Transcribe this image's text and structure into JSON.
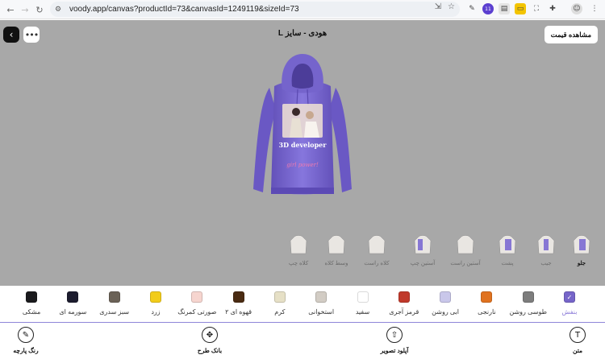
{
  "browser": {
    "url": "voody.app/canvas?productId=73&canvasId=1249119&sizeId=73",
    "extension_badge": "11"
  },
  "header": {
    "title": "هودی - سایز L",
    "price_button": "مشاهده قیمت"
  },
  "design": {
    "print_text": "3D developer",
    "print_subtext": "girl power!"
  },
  "views": [
    {
      "label": "جلو",
      "active": true,
      "color": "#7c6ad3"
    },
    {
      "label": "جیب",
      "active": false,
      "color": "#7c6ad3"
    },
    {
      "label": "پشت",
      "active": false,
      "color": "#7c6ad3"
    },
    {
      "label": "آستین راست",
      "active": false,
      "color": "#d7d4d0"
    },
    {
      "label": "آستین چپ",
      "active": false,
      "color": "#7c6ad3"
    },
    {
      "label": "کلاه راست",
      "active": false,
      "color": "#d7d4d0"
    },
    {
      "label": "وسط کلاه",
      "active": false,
      "color": "#d7d4d0"
    },
    {
      "label": "کلاه چپ",
      "active": false,
      "color": "#d7d4d0"
    }
  ],
  "colors": [
    {
      "name": "بنفش",
      "hex": "#7665c9",
      "selected": true
    },
    {
      "name": "طوسی روشن",
      "hex": "#7d7d7d",
      "selected": false
    },
    {
      "name": "نارنجی",
      "hex": "#e0721f",
      "selected": false
    },
    {
      "name": "ابی روشن",
      "hex": "#c9c7ea",
      "selected": false
    },
    {
      "name": "قرمز آجری",
      "hex": "#c0392b",
      "selected": false
    },
    {
      "name": "سفید",
      "hex": "#ffffff",
      "selected": false
    },
    {
      "name": "استخوانی",
      "hex": "#d2ccc4",
      "selected": false
    },
    {
      "name": "کرم",
      "hex": "#e6e0c6",
      "selected": false
    },
    {
      "name": "قهوه ای ۲",
      "hex": "#4a2b12",
      "selected": false
    },
    {
      "name": "صورتی کمرنگ",
      "hex": "#f6d5cf",
      "selected": false
    },
    {
      "name": "زرد",
      "hex": "#f2cc1a",
      "selected": false
    },
    {
      "name": "سبز سدری",
      "hex": "#6b6257",
      "selected": false
    },
    {
      "name": "سورمه ای",
      "hex": "#1c1c2e",
      "selected": false
    },
    {
      "name": "مشکی",
      "hex": "#1a1a1d",
      "selected": false
    }
  ],
  "toolbar": {
    "text": "متن",
    "upload": "آپلود تصویر",
    "pattern_bank": "بانک طرح",
    "fabric_color": "رنگ پارچه"
  },
  "accent": "#7665c9"
}
